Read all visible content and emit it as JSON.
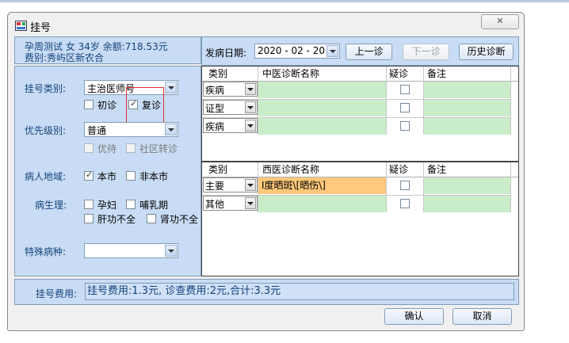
{
  "window": {
    "title": "挂号",
    "close_symbol": "✕"
  },
  "patient": {
    "line1": "孕周测试  女  34岁  余额:718.53元",
    "line2": "费别:秀屿区新农合"
  },
  "visit": {
    "date_label": "发病日期:",
    "date_value": "2020 - 02 - 20",
    "prev_label": "上一诊",
    "next_label": "下一诊",
    "history_label": "历史诊断"
  },
  "form": {
    "reg_type_label": "挂号类别:",
    "reg_type_value": "主治医师号",
    "first_visit_label": "初诊",
    "revisit_label": "复诊",
    "revisit_checked": true,
    "priority_label": "优先级别:",
    "priority_value": "普通",
    "preferential_label": "优待",
    "community_label": "社区转诊",
    "region_label": "病人地域:",
    "local_label": "本市",
    "local_checked": true,
    "nonlocal_label": "非本市",
    "physio_label": "病生理:",
    "pregnant_label": "孕妇",
    "lactation_label": "哺乳期",
    "liver_label": "肝功不全",
    "kidney_label": "肾功不全",
    "special_label": "特殊病种:",
    "special_value": "",
    "check_mark": "✓"
  },
  "tcm_grid": {
    "headers": [
      "类别",
      "中医诊断名称",
      "疑诊",
      "备注"
    ],
    "rows": [
      {
        "type": "疾病",
        "name": "",
        "note": ""
      },
      {
        "type": "证型",
        "name": "",
        "note": ""
      },
      {
        "type": "疾病",
        "name": "",
        "note": ""
      }
    ]
  },
  "wm_grid": {
    "headers": [
      "类别",
      "西医诊断名称",
      "疑诊",
      "备注"
    ],
    "rows": [
      {
        "type": "主要",
        "name": "I度晒斑\\[晒伤\\]",
        "note": ""
      },
      {
        "type": "其他",
        "name": "",
        "note": ""
      }
    ]
  },
  "fee": {
    "label": "挂号费用:",
    "value": "挂号费用:1.3元, 诊查费用:2元,合计:3.3元"
  },
  "actions": {
    "confirm_label": "确认",
    "cancel_label": "取消"
  },
  "colors": {
    "panel": "#c9dcf5",
    "grid_cell": "#c9edc9",
    "highlight_cell": "#ffc87a",
    "annotation_box": "#e03030"
  }
}
